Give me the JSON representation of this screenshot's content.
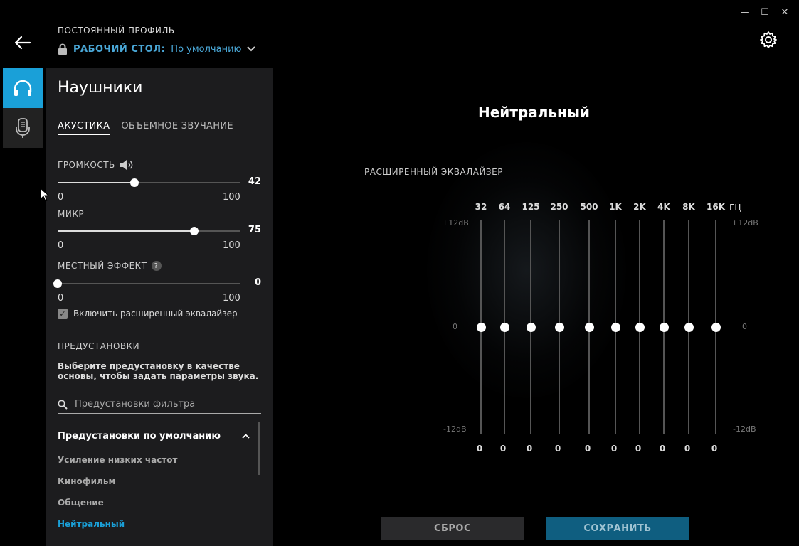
{
  "window": {
    "minimize": "—",
    "maximize": "☐",
    "close": "✕"
  },
  "profile": {
    "caption": "ПОСТОЯННЫЙ ПРОФИЛЬ",
    "desktop": "РАБОЧИЙ СТОЛ:",
    "value": "По умолчанию"
  },
  "panel": {
    "title": "Наушники",
    "tabs": [
      {
        "label": "АКУСТИКА"
      },
      {
        "label": "ОБЪЕМНОЕ ЗВУЧАНИЕ"
      }
    ],
    "volume": {
      "label": "ГРОМКОСТЬ",
      "value": "42",
      "min": "0",
      "max": "100",
      "fraction": 0.42
    },
    "mic": {
      "label": "МИКР",
      "value": "75",
      "min": "0",
      "max": "100",
      "fraction": 0.75
    },
    "sidetone": {
      "label": "МЕСТНЫЙ ЭФФЕКТ",
      "value": "0",
      "min": "0",
      "max": "100",
      "fraction": 0.0,
      "help": "?"
    },
    "advanced_eq_checkbox": {
      "label": "Включить расширенный эквалайзер",
      "checked": true,
      "mark": "✓"
    },
    "presets": {
      "heading": "ПРЕДУСТАНОВКИ",
      "description": "Выберите предустановку в качестве основы, чтобы задать параметры звука.",
      "search_placeholder": "Предустановки фильтра",
      "group": "Предустановки по умолчанию",
      "items": [
        "Усиление низких частот",
        "Кинофильм",
        "Общение",
        "Нейтральный"
      ],
      "selected": "Нейтральный"
    }
  },
  "eq": {
    "title": "Нейтральный",
    "caption": "РАСШИРЕННЫЙ ЭКВАЛАЙЗЕР",
    "unit": "ГЦ",
    "db_top": "+12dB",
    "db_mid": "0",
    "db_bottom": "-12dB",
    "bands": [
      {
        "freq": "32",
        "value": "0"
      },
      {
        "freq": "64",
        "value": "0"
      },
      {
        "freq": "125",
        "value": "0"
      },
      {
        "freq": "250",
        "value": "0"
      },
      {
        "freq": "500",
        "value": "0"
      },
      {
        "freq": "1K",
        "value": "0"
      },
      {
        "freq": "2K",
        "value": "0"
      },
      {
        "freq": "4K",
        "value": "0"
      },
      {
        "freq": "8K",
        "value": "0"
      },
      {
        "freq": "16K",
        "value": "0"
      }
    ]
  },
  "buttons": {
    "reset": "СБРОС",
    "save": "СОХРАНИТЬ"
  },
  "colors": {
    "accent": "#1aa0d8",
    "save_bg": "#0f5e80",
    "panel_bg": "#1c1c1e"
  }
}
